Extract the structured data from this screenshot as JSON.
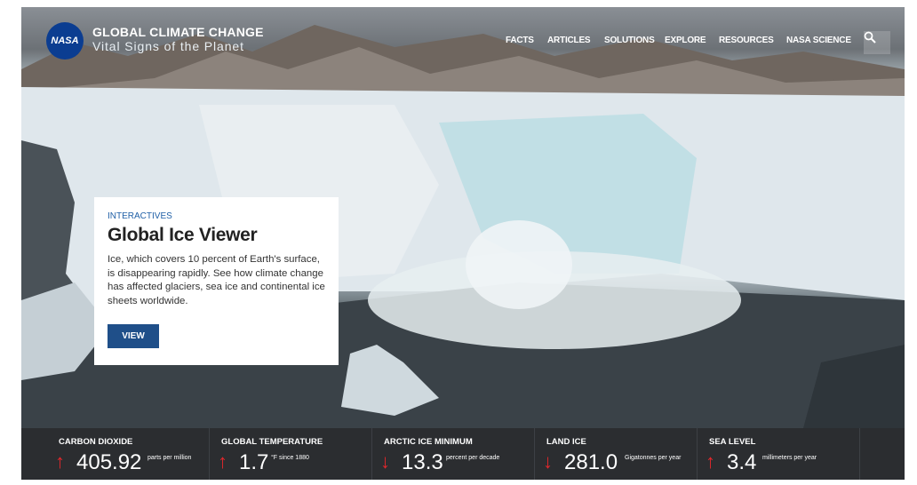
{
  "header": {
    "logo_text": "NASA",
    "site_title": "GLOBAL CLIMATE CHANGE",
    "site_tagline": "Vital Signs of the Planet",
    "nav": [
      "FACTS",
      "ARTICLES",
      "SOLUTIONS",
      "EXPLORE",
      "RESOURCES",
      "NASA SCIENCE"
    ],
    "search_icon": "search-icon"
  },
  "feature": {
    "eyebrow": "INTERACTIVES",
    "title": "Global Ice Viewer",
    "description": "Ice, which covers 10 percent of Earth's surface, is disappearing rapidly. See how climate change has affected glaciers, sea ice and continental ice sheets worldwide.",
    "button_label": "VIEW"
  },
  "stats": [
    {
      "label": "CARBON DIOXIDE",
      "direction": "up",
      "arrow": "↑",
      "value": "405.92",
      "unit": "parts per million"
    },
    {
      "label": "GLOBAL TEMPERATURE",
      "direction": "up",
      "arrow": "↑",
      "value": "1.7",
      "unit": "°F since 1880"
    },
    {
      "label": "ARCTIC ICE MINIMUM",
      "direction": "down",
      "arrow": "↓",
      "value": "13.3",
      "unit": "percent per decade"
    },
    {
      "label": "LAND ICE",
      "direction": "down",
      "arrow": "↓",
      "value": "281.0",
      "unit": "Gigatonnes per year"
    },
    {
      "label": "SEA LEVEL",
      "direction": "up",
      "arrow": "↑",
      "value": "3.4",
      "unit": "millimeters per year"
    }
  ],
  "colors": {
    "nasa_blue": "#0b3d91",
    "eyebrow_blue": "#1f5fa6",
    "button_blue": "#1f4f89",
    "stats_bg": "#2b2d30",
    "arrow_red": "#e2272c"
  }
}
